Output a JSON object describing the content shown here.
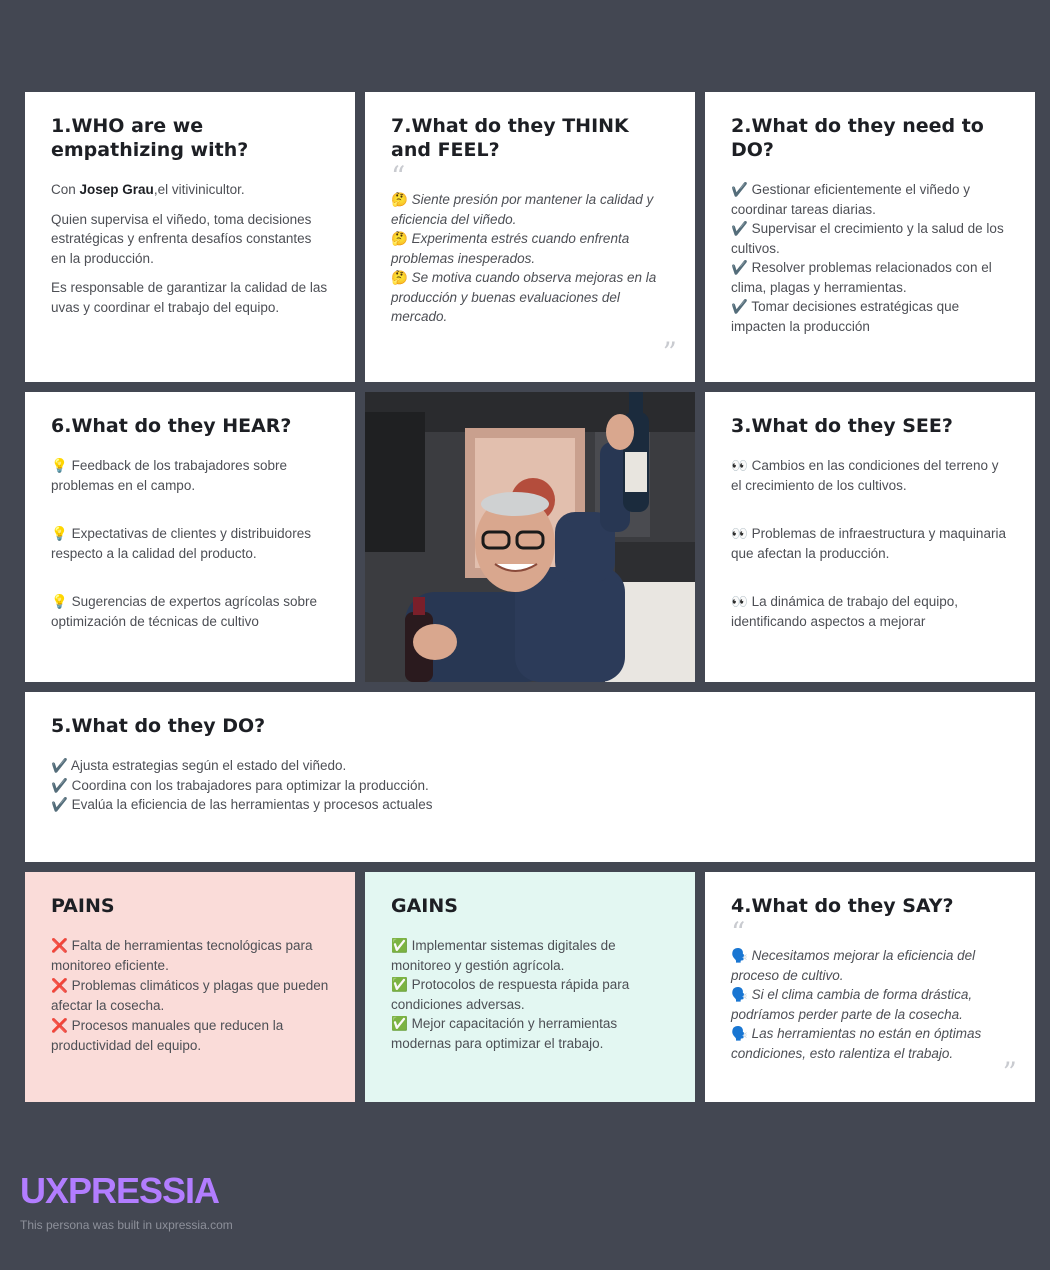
{
  "who": {
    "title": "1.WHO are we empathizing with?",
    "intro_prefix": "Con ",
    "name": "Josep Grau",
    "intro_suffix": ",el vitivinicultor.",
    "p2": "Quien supervisa el viñedo, toma decisiones estratégicas y enfrenta desafíos constantes en la producción.",
    "p3": "Es responsable de garantizar la calidad de las uvas y coordinar el trabajo del equipo."
  },
  "think_feel": {
    "title": "7.What do they THINK and FEEL?",
    "icon": "🤔",
    "items": [
      "Siente presión por mantener la calidad y eficiencia del viñedo.",
      "Experimenta estrés cuando enfrenta problemas inesperados.",
      "Se motiva cuando observa mejoras en la producción y buenas evaluaciones del mercado."
    ]
  },
  "need_do": {
    "title": "2.What do they need to DO?",
    "icon": "✔️",
    "items": [
      "Gestionar eficientemente el viñedo y coordinar tareas diarias.",
      "Supervisar el crecimiento y la salud de los cultivos.",
      "Resolver problemas relacionados con el clima, plagas y herramientas.",
      "Tomar decisiones estratégicas que impacten la producción"
    ]
  },
  "hear": {
    "title": "6.What do they HEAR?",
    "icon": "💡",
    "items": [
      "Feedback de los trabajadores sobre problemas en el campo.",
      "Expectativas de clientes y distribuidores respecto a la calidad del producto.",
      "Sugerencias de expertos agrícolas sobre optimización de técnicas de cultivo"
    ]
  },
  "see": {
    "title": "3.What do they SEE?",
    "icon": "👀",
    "items": [
      "Cambios en las condiciones del terreno y el crecimiento de los cultivos.",
      "Problemas de infraestructura y maquinaria que afectan la producción.",
      "La dinámica de trabajo del equipo, identificando aspectos a mejorar"
    ]
  },
  "do": {
    "title": "5.What do they DO?",
    "icon": "✔️",
    "items": [
      "Ajusta estrategias según el estado del viñedo.",
      "Coordina con los trabajadores para optimizar la producción.",
      "Evalúa la eficiencia de las herramientas y procesos actuales"
    ]
  },
  "pains": {
    "title": "PAINS",
    "icon": "❌",
    "bg": "#fadcd9",
    "items": [
      "Falta de herramientas tecnológicas para monitoreo eficiente.",
      "Problemas climáticos y plagas que pueden afectar la cosecha.",
      "Procesos manuales que reducen la productividad del equipo."
    ]
  },
  "gains": {
    "title": "GAINS",
    "icon": "✅",
    "bg": "#e3f7f2",
    "items": [
      "Implementar sistemas digitales de monitoreo y gestión agrícola.",
      "Protocolos de respuesta rápida para condiciones adversas.",
      "Mejor capacitación y herramientas modernas para optimizar el trabajo."
    ]
  },
  "say": {
    "title": "4.What do they SAY?",
    "icon": "🗣️",
    "items": [
      "Necesitamos mejorar la eficiencia del proceso de cultivo.",
      "Si el clima cambia de forma drástica, podríamos perder parte de la cosecha.",
      "Las herramientas no están en óptimas condiciones, esto ralentiza el trabajo."
    ]
  },
  "quotes": {
    "open": "“",
    "close": "”"
  },
  "brand": {
    "logo": "UXPRESSIA",
    "footer": "This persona was built in uxpressia.com",
    "accent": "#b27dff",
    "background": "#434752"
  }
}
